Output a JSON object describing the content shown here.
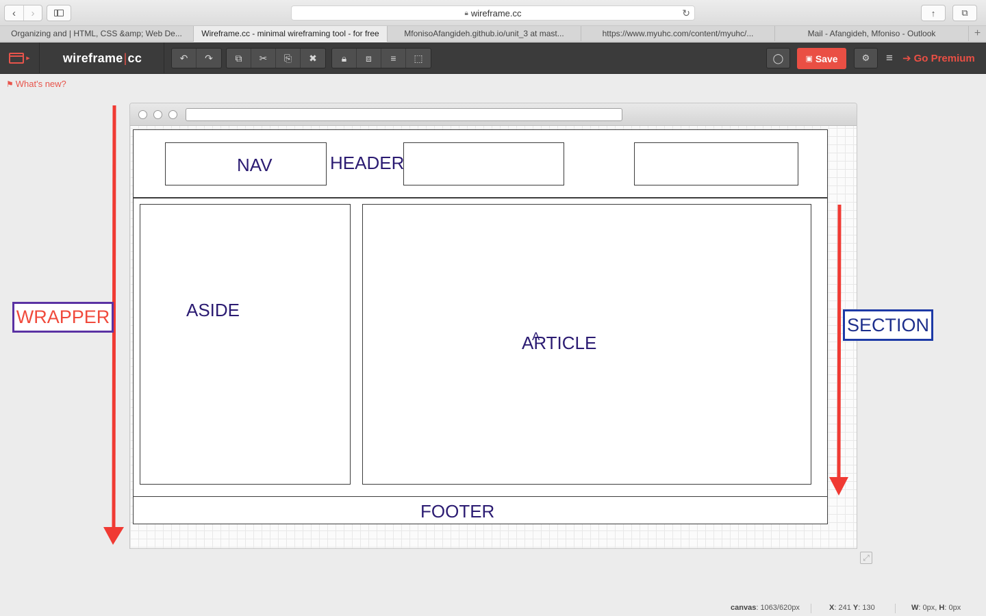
{
  "browser": {
    "address": "wireframe.cc",
    "tabs": [
      {
        "label": "Organizing and | HTML, CSS &amp; Web De..."
      },
      {
        "label": "Wireframe.cc - minimal wireframing tool - for free"
      },
      {
        "label": "MfonisoAfangideh.github.io/unit_3 at mast..."
      },
      {
        "label": "https://www.myuhc.com/content/myuhc/..."
      },
      {
        "label": "Mail - Afangideh, Mfoniso - Outlook"
      }
    ],
    "active_tab": 1
  },
  "app": {
    "brand_left": "wireframe",
    "brand_right": "cc",
    "save_label": "Save",
    "premium_label": "Go Premium",
    "whats_new": "What's new?"
  },
  "wireframe": {
    "nav": "NAV",
    "header": "HEADER",
    "aside": "ASIDE",
    "article": "ARTICLE",
    "article_cursor": "A",
    "footer": "FOOTER"
  },
  "annotations": {
    "wrapper": "WRAPPER",
    "section": "SECTION",
    "arrow_color": "#f03a33",
    "wrapper_border": "#5a32a3",
    "section_border": "#1d3aa6"
  },
  "status": {
    "canvas_label": "canvas",
    "canvas_value": "1063/620px",
    "x_label": "X",
    "x_value": "241",
    "y_label": "Y",
    "y_value": "130",
    "w_label": "W",
    "w_value": "0px",
    "h_label": "H",
    "h_value": "0px"
  },
  "colors": {
    "accent": "#ea4f44",
    "toolbar": "#3b3b3b",
    "label_text": "#2b1b72"
  }
}
